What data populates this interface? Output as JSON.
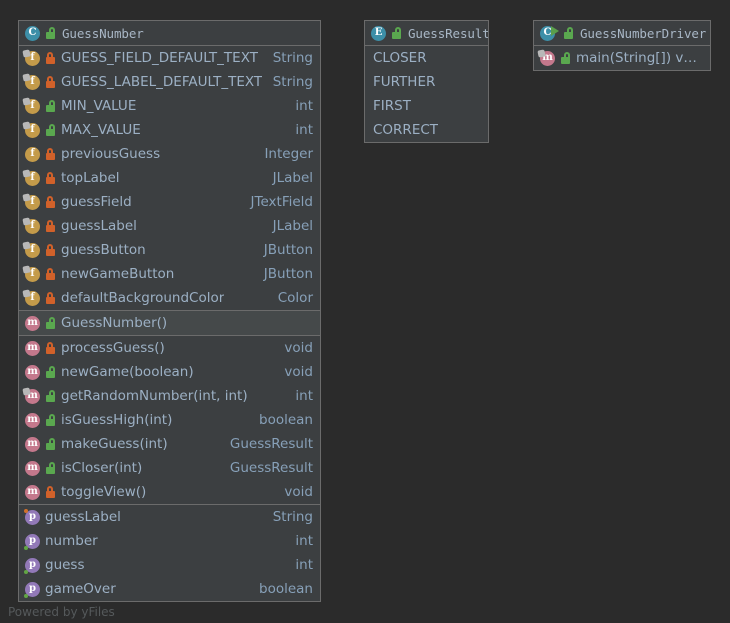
{
  "canvas": {
    "background_color": "#2b2b2b",
    "watermark": "Powered by yFiles"
  },
  "colors": {
    "box_background": "#3c3f41",
    "box_border": "#6b6b6b",
    "member_name": "#9cb0c4",
    "member_type": "#87a0b8",
    "class_icon": "#3d8fa8",
    "field_icon": "#c49b4a",
    "method_icon": "#c4788c",
    "property_icon": "#9279b8",
    "lock_public": "#5aa84f",
    "lock_private": "#d1612a",
    "run_arrow": "#5a9e4b"
  },
  "boxes": {
    "guess_number": {
      "title": "GuessNumber",
      "type_icon": "class-icon",
      "visibility_icon": "padlock-public-icon",
      "fields": [
        {
          "icon": "static-field-icon",
          "lock": "padlock-private-icon",
          "name": "GUESS_FIELD_DEFAULT_TEXT",
          "type": "String"
        },
        {
          "icon": "static-field-icon",
          "lock": "padlock-private-icon",
          "name": "GUESS_LABEL_DEFAULT_TEXT",
          "type": "String"
        },
        {
          "icon": "static-field-icon",
          "lock": "padlock-public-icon",
          "name": "MIN_VALUE",
          "type": "int"
        },
        {
          "icon": "static-field-icon",
          "lock": "padlock-public-icon",
          "name": "MAX_VALUE",
          "type": "int"
        },
        {
          "icon": "field-icon",
          "lock": "padlock-private-icon",
          "name": "previousGuess",
          "type": "Integer"
        },
        {
          "icon": "static-field-icon",
          "lock": "padlock-private-icon",
          "name": "topLabel",
          "type": "JLabel"
        },
        {
          "icon": "static-field-icon",
          "lock": "padlock-private-icon",
          "name": "guessField",
          "type": "JTextField"
        },
        {
          "icon": "static-field-icon",
          "lock": "padlock-private-icon",
          "name": "guessLabel",
          "type": "JLabel"
        },
        {
          "icon": "static-field-icon",
          "lock": "padlock-private-icon",
          "name": "guessButton",
          "type": "JButton"
        },
        {
          "icon": "static-field-icon",
          "lock": "padlock-private-icon",
          "name": "newGameButton",
          "type": "JButton"
        },
        {
          "icon": "static-field-icon",
          "lock": "padlock-private-icon",
          "name": "defaultBackgroundColor",
          "type": "Color"
        }
      ],
      "constructors": [
        {
          "icon": "method-icon",
          "lock": "padlock-public-icon",
          "name": "GuessNumber()",
          "type": ""
        }
      ],
      "methods": [
        {
          "icon": "method-icon",
          "lock": "padlock-private-icon",
          "name": "processGuess()",
          "type": "void"
        },
        {
          "icon": "method-icon",
          "lock": "padlock-public-icon",
          "name": "newGame(boolean)",
          "type": "void"
        },
        {
          "icon": "static-method-icon",
          "lock": "padlock-public-icon",
          "name": "getRandomNumber(int, int)",
          "type": "int"
        },
        {
          "icon": "method-icon",
          "lock": "padlock-public-icon",
          "name": "isGuessHigh(int)",
          "type": "boolean"
        },
        {
          "icon": "method-icon",
          "lock": "padlock-public-icon",
          "name": "makeGuess(int)",
          "type": "GuessResult"
        },
        {
          "icon": "method-icon",
          "lock": "padlock-public-icon",
          "name": "isCloser(int)",
          "type": "GuessResult"
        },
        {
          "icon": "method-icon",
          "lock": "padlock-private-icon",
          "name": "toggleView()",
          "type": "void"
        }
      ],
      "properties": [
        {
          "icon": "property-icon",
          "dot": "orange",
          "name": "guessLabel",
          "type": "String"
        },
        {
          "icon": "property-icon",
          "dot": "green",
          "name": "number",
          "type": "int"
        },
        {
          "icon": "property-icon",
          "dot": "green",
          "name": "guess",
          "type": "int"
        },
        {
          "icon": "property-icon",
          "dot": "green",
          "name": "gameOver",
          "type": "boolean"
        }
      ]
    },
    "guess_result": {
      "title": "GuessResult",
      "type_icon": "enum-icon",
      "visibility_icon": "padlock-public-icon",
      "constants": [
        {
          "name": "CLOSER"
        },
        {
          "name": "FURTHER"
        },
        {
          "name": "FIRST"
        },
        {
          "name": "CORRECT"
        }
      ]
    },
    "guess_number_driver": {
      "title": "GuessNumberDriver",
      "type_icon": "runnable-class-icon",
      "visibility_icon": "padlock-public-icon",
      "methods": [
        {
          "icon": "static-method-icon",
          "lock": "padlock-public-icon",
          "name": "main(String[]) void",
          "type": ""
        }
      ]
    }
  }
}
